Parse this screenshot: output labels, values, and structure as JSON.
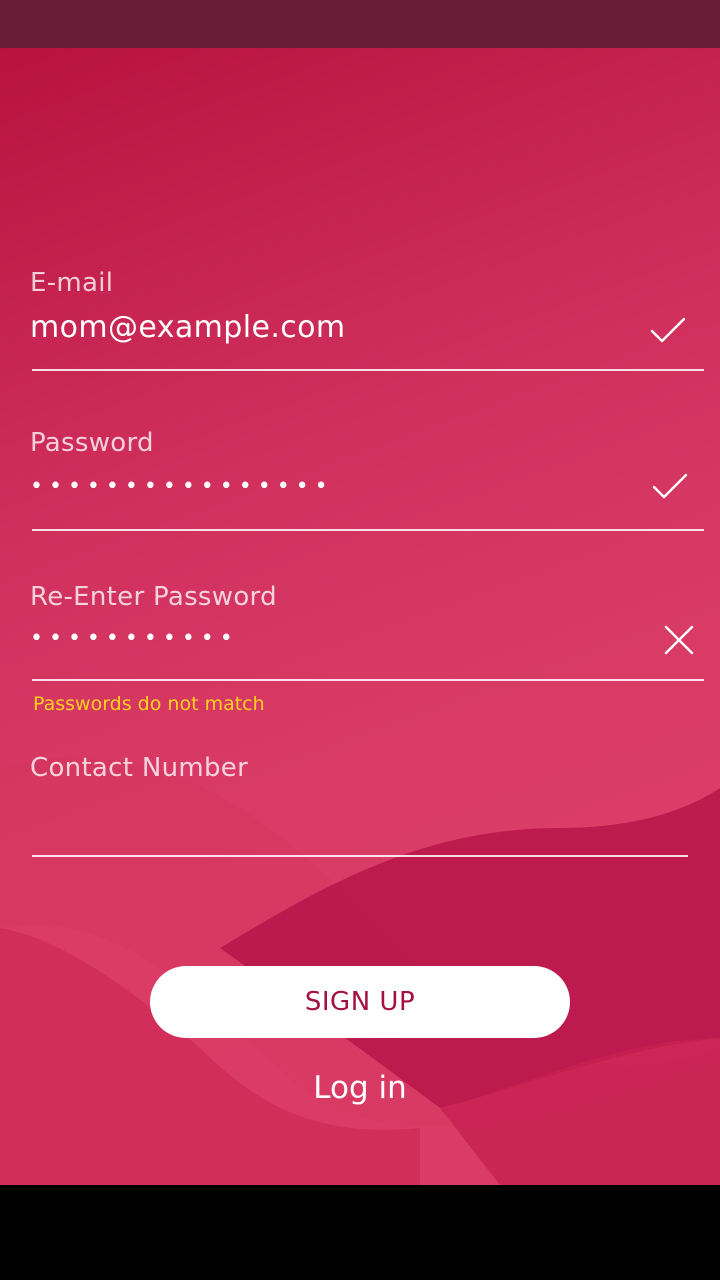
{
  "form": {
    "email": {
      "label": "E-mail",
      "value": "mom@example.com",
      "status_icon": "check-icon"
    },
    "password": {
      "label": "Password",
      "value": "••••••••••••••••",
      "status_icon": "check-icon"
    },
    "reenter_password": {
      "label": "Re-Enter Password",
      "value": "•••••••••••",
      "status_icon": "close-icon",
      "error": "Passwords do not match"
    },
    "contact": {
      "label": "Contact Number",
      "value": ""
    }
  },
  "actions": {
    "signup_label": "SIGN UP",
    "login_label": "Log in"
  },
  "colors": {
    "status_bar": "#6a1d36",
    "background": "#d02f5c",
    "button_text": "#a31041",
    "error": "#ffd21c"
  }
}
